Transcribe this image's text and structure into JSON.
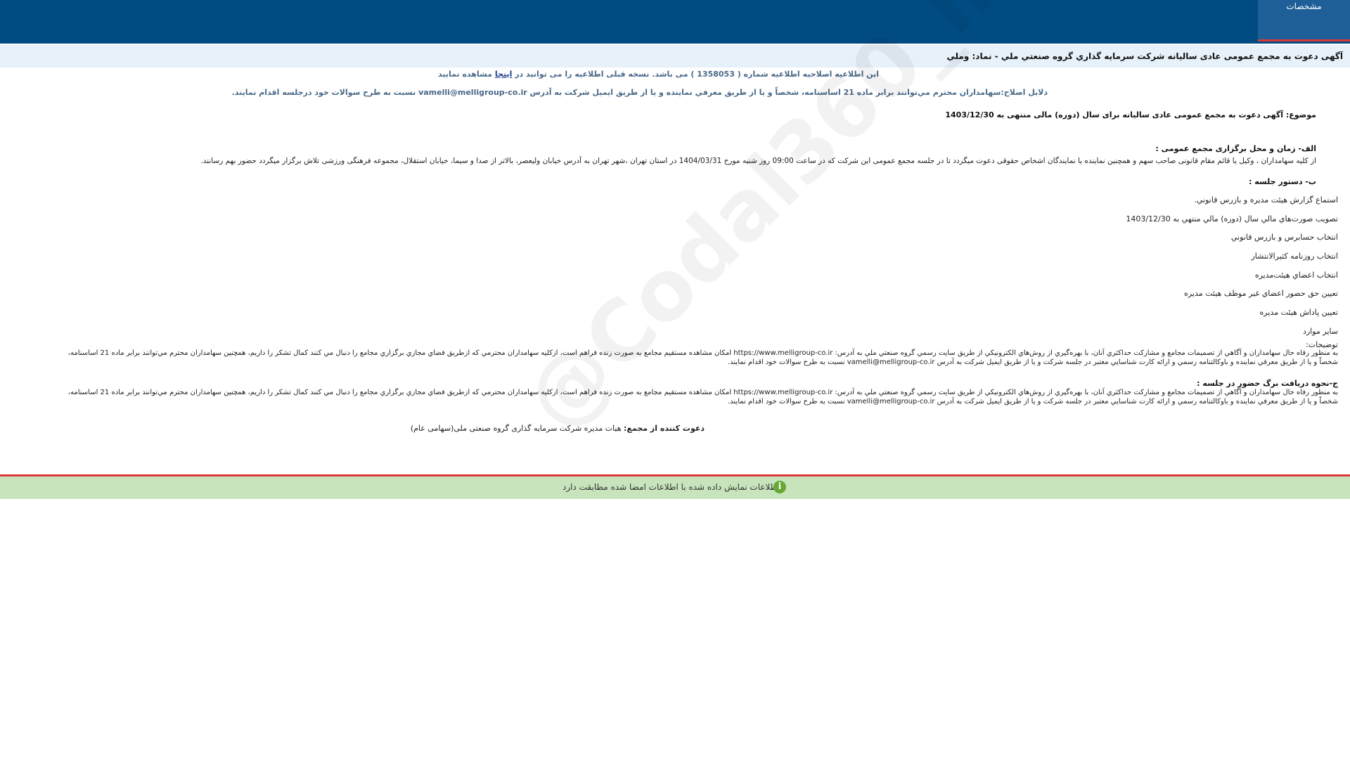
{
  "header": {
    "tab_label": "مشخصات"
  },
  "title": "آگهی دعوت به مجمع عمومی عادی سالیانه شرکت سرمایه گذاري گروه صنعتي ملي - نماد: وملي",
  "correction_notice": {
    "before_number": "این اطلاعیه اصلاحیه اطلاعیه شماره (",
    "number": "1358053",
    "after_number": ") می باشد. نسخه قبلی اطلاعیه را می توانید در",
    "link_text": "اینجا",
    "after_link": "مشاهده نمایید"
  },
  "correction_reason": "دلایل اصلاح:سهامداران محترم مي‌توانند برابر ماده 21 اساسنامه، شخصاً و يا از طريق معرفي نماينده و يا از طريق ايميل شركت به آدرس vamelli@melligroup-co.ir نسبت به طرح سوالات خود درجلسه اقدام نمايند.",
  "subject": {
    "label": "موضوع:",
    "text": "آگهی دعوت به مجمع عمومی عادی سالیانه برای سال (دوره) مالی منتهی به",
    "date": "1403/12/30"
  },
  "section_a": {
    "heading": "الف- زمان و محل برگزاری مجمع عمومی :",
    "text": "از کلیه سهامداران ، وکیل یا قائم مقام قانونی صاحب سهم و همچنین نماینده یا نمایندگان اشخاص حقوقی دعوت میگردد تا در جلسه مجمع عمومی این شرکت که در ساعت 09:00 روز شنبه مورخ 1404/03/31 در استان تهران ،شهر تهران به آدرس خیابان ولیعصر، بالاتر از صدا و سیما، خیابان استقلال، مجموعه فرهنگی ورزشی تلاش برگزار میگردد حضور بهم رسانند."
  },
  "section_b": {
    "heading": "ب- دستور جلسه :",
    "items": [
      "استماع گزارش هيئت مديره و بازرس قانوني.",
      "تصويب صورت‌هاي مالي سال (دوره) مالي منتهي به 1403/12/30",
      "انتخاب حسابرس و بازرس قانوني",
      "انتخاب روزنامه كثيرالانتشار",
      "انتخاب اعضاي هيئت‌مديره",
      "تعيين حق حضور اعضاي غير موظف هيئت مديره",
      "تعيين پاداش هيئت مديره",
      "ساير موارد"
    ]
  },
  "notes": {
    "label": "توضیحات:",
    "line1": "به منظور رفاه حال سهامداران و آگاهي از تصميمات مجامع و مشاركت حداكثري آنان، با بهره‌گيري از روش‌هاي الكترونيكي از طريق سايت رسمي گروه صنعتي ملي به آدرس: https://www.melligroup-co.ir امكان مشاهده مستقيم مجامع به صورت زنده فراهم است، ازكليه سهامداران محترمي كه ازطريق فضاي مجازي برگزاري مجامع را دنبال مي كنند كمال تشكر را داريم، همچنين سهامداران محترم مي‌توانند برابر ماده 21 اساسنامه،",
    "line2": "شخصاً و يا از طريق معرفي نماينده و باوكالتنامه رسمي و ارائه كارت شناسايي معتبر در جلسه شركت و يا از طريق ايميل شركت به آدرس vamelli@melligroup-co.ir نسبت به طرح سوالات خود اقدام نمايند."
  },
  "section_c": {
    "heading": "ج-نحوه دریافت برگ حضور در جلسه :",
    "line1": "به منظور رفاه حال سهامداران و آگاهي از تصميمات مجامع و مشاركت حداكثري آنان، با بهره‌گيري از روش‌هاي الكترونيكي از طريق سايت رسمي گروه صنعتي ملي به آدرس: https://www.melligroup-co.ir امكان مشاهده مستقيم مجامع به صورت زنده فراهم است، ازكليه سهامداران محترمي كه ازطريق فضاي مجازي برگزاري مجامع را دنبال مي كنند كمال تشكر را داريم، همچنين سهامداران محترم مي‌توانند برابر ماده 21 اساسنامه،",
    "line2": "شخصاً و يا از طريق معرفي نماينده و باوكالتنامه رسمي و ارائه كارت شناسايي معتبر در جلسه شركت و يا از طريق ايميل شركت به آدرس vamelli@melligroup-co.ir نسبت به طرح سوالات خود اقدام نمايند."
  },
  "inviter": {
    "label": "دعوت کننده از مجمع:",
    "text": "هیات مدیره شرکت سرمایه گذاری گروه صنعتی ملی(سهامی عام)"
  },
  "footer": {
    "message": "اطلاعات نمایش داده شده با اطلاعات امضا شده مطابقت دارد",
    "icon": "info-icon"
  },
  "watermark": "@Codal360_ir"
}
